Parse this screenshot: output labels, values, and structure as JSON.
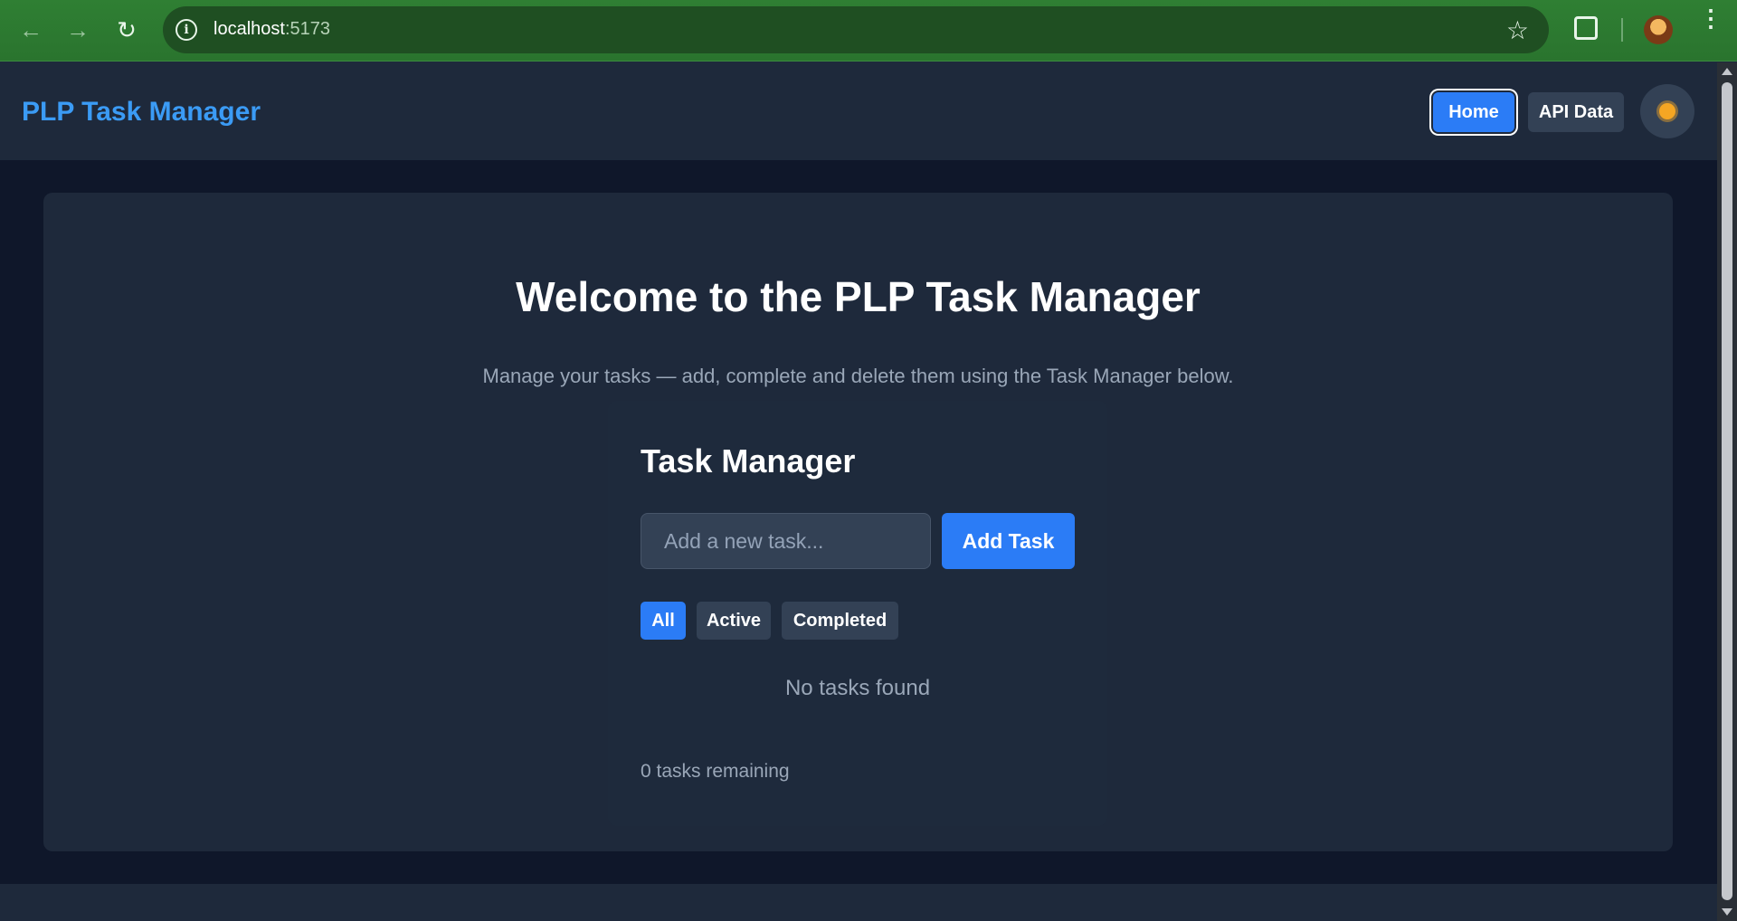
{
  "browser": {
    "url_host": "localhost",
    "url_port": ":5173",
    "icons": {
      "back": "back-arrow-icon",
      "forward": "forward-arrow-icon",
      "reload": "reload-icon",
      "site_info": "info-icon",
      "bookmark": "star-icon",
      "extensions": "puzzle-icon",
      "menu": "kebab-menu-icon"
    }
  },
  "header": {
    "brand": "PLP Task Manager",
    "nav": [
      {
        "label": "Home",
        "active": true
      },
      {
        "label": "API Data",
        "active": false
      }
    ],
    "theme_toggle_icon": "sun-icon"
  },
  "main": {
    "title": "Welcome to the PLP Task Manager",
    "subtitle": "Manage your tasks — add, complete and delete them using the Task Manager below."
  },
  "task_manager": {
    "title": "Task Manager",
    "input_placeholder": "Add a new task...",
    "input_value": "",
    "add_label": "Add Task",
    "filters": [
      {
        "label": "All",
        "active": true
      },
      {
        "label": "Active",
        "active": false
      },
      {
        "label": "Completed",
        "active": false
      }
    ],
    "empty_text": "No tasks found",
    "remaining_text": "0 tasks remaining"
  },
  "colors": {
    "accent": "#2b7cf6",
    "brand": "#3b9bf5",
    "page_bg": "#0f172a",
    "card_bg": "#1e293b",
    "browser_frame": "#2e7d32"
  }
}
